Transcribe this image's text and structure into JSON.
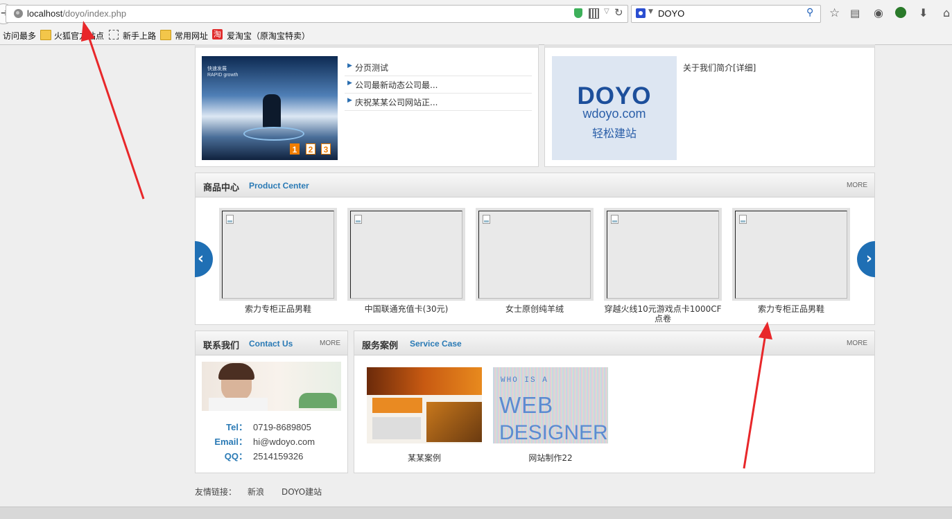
{
  "browser": {
    "url_host": "localhost",
    "url_path": "/doyo/index.php",
    "search_value": "DOYO",
    "icons": [
      "back-icon",
      "globe-icon",
      "shield-icon",
      "qr-icon",
      "reload-icon",
      "baidu-paw-icon",
      "search-icon",
      "bookmark-star-icon",
      "reader-icon",
      "palette-icon",
      "shield-green-icon",
      "download-icon",
      "home-icon"
    ]
  },
  "bookmarks": [
    {
      "label": "访问最多"
    },
    {
      "label": "火狐官方站点"
    },
    {
      "label": "新手上路"
    },
    {
      "label": "常用网址"
    },
    {
      "label": "爱淘宝（原淘宝特卖）",
      "icon_text": "淘"
    }
  ],
  "news": {
    "slider_lines": [
      "快速发展",
      "RAPID growth"
    ],
    "slider_pages": [
      "1",
      "2",
      "3"
    ],
    "items": [
      "分页测试",
      "公司最新动态公司最...",
      "庆祝某某公司网站正..."
    ]
  },
  "about": {
    "logo_brand": "DOYO",
    "logo_domain": "wdoyo.com",
    "logo_slogan": "轻松建站",
    "text": "关于我们简介[详细]"
  },
  "products": {
    "title_cn": "商品中心",
    "title_en": "Product Center",
    "more": "MORE",
    "items": [
      {
        "label": "索力专柜正品男鞋"
      },
      {
        "label": "中国联通充值卡(30元)"
      },
      {
        "label": "女士原创纯羊绒"
      },
      {
        "label": "穿越火线10元游戏点卡1000CF点卷"
      },
      {
        "label": "索力专柜正品男鞋"
      }
    ]
  },
  "contact": {
    "title_cn": "联系我们",
    "title_en": "Contact Us",
    "more": "MORE",
    "tel_label": "Tel：",
    "tel": "0719-8689805",
    "email_label": "Email：",
    "email": "hi@wdoyo.com",
    "qq_label": "QQ：",
    "qq": "2514159326"
  },
  "cases": {
    "title_cn": "服务案例",
    "title_en": "Service Case",
    "more": "MORE",
    "items": [
      {
        "label": "某某案例"
      },
      {
        "label": "网站制作22",
        "thumb_lines": [
          "WHO IS A",
          "WEB",
          "DESIGNER"
        ]
      }
    ]
  },
  "friend_links": {
    "label": "友情链接：",
    "links": [
      "新浪",
      "DOYO建站"
    ]
  },
  "colors": {
    "accent_blue": "#2a7ab5",
    "slider_orange": "#f07d00",
    "annotation_red": "#e8272a"
  }
}
